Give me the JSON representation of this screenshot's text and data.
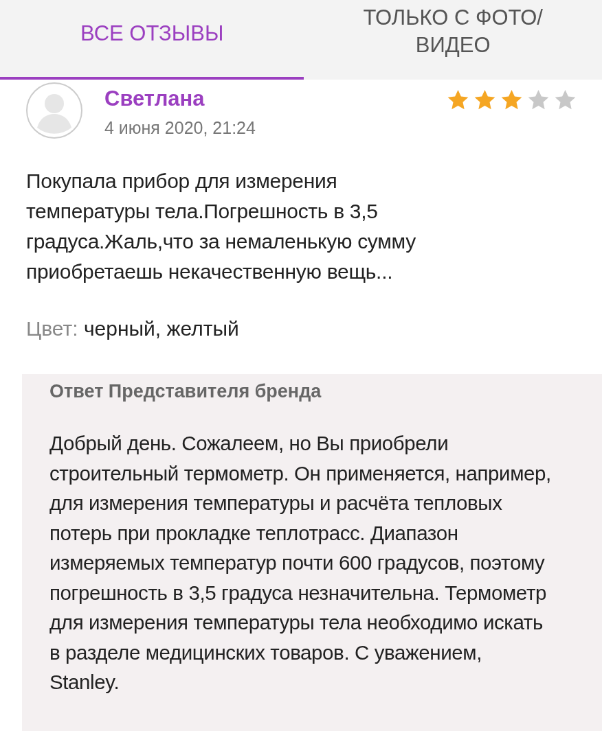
{
  "tabs": [
    {
      "label": "ВСЕ ОТЗЫВЫ",
      "selected": true
    },
    {
      "label": "ТОЛЬКО С ФОТО/ ВИДЕО",
      "selected": false
    }
  ],
  "review": {
    "author": "Светлана",
    "date": "4 июня 2020, 21:24",
    "stars": 3,
    "text": "Покупала прибор для измерения температуры тела.Погрешность в  3,5 градуса.Жаль,что за немаленькую сумму приобретаешь некачественную вещь...",
    "color_label": "Цвет:",
    "color_value": "черный, желтый"
  },
  "reply": {
    "title": "Ответ Представителя бренда",
    "text": "Добрый день. Сожалеем, но Вы приобрели строительный термометр. Он применяется, например, для измерения температуры и расчёта тепловых потерь при прокладке теплотрасс. Диапазон измеряемых температур почти 600 градусов, поэтому погрешность в 3,5 градуса незначительна. Термометр для измерения температуры тела необходимо искать в разделе медицинских товаров. С уважением, Stanley."
  }
}
